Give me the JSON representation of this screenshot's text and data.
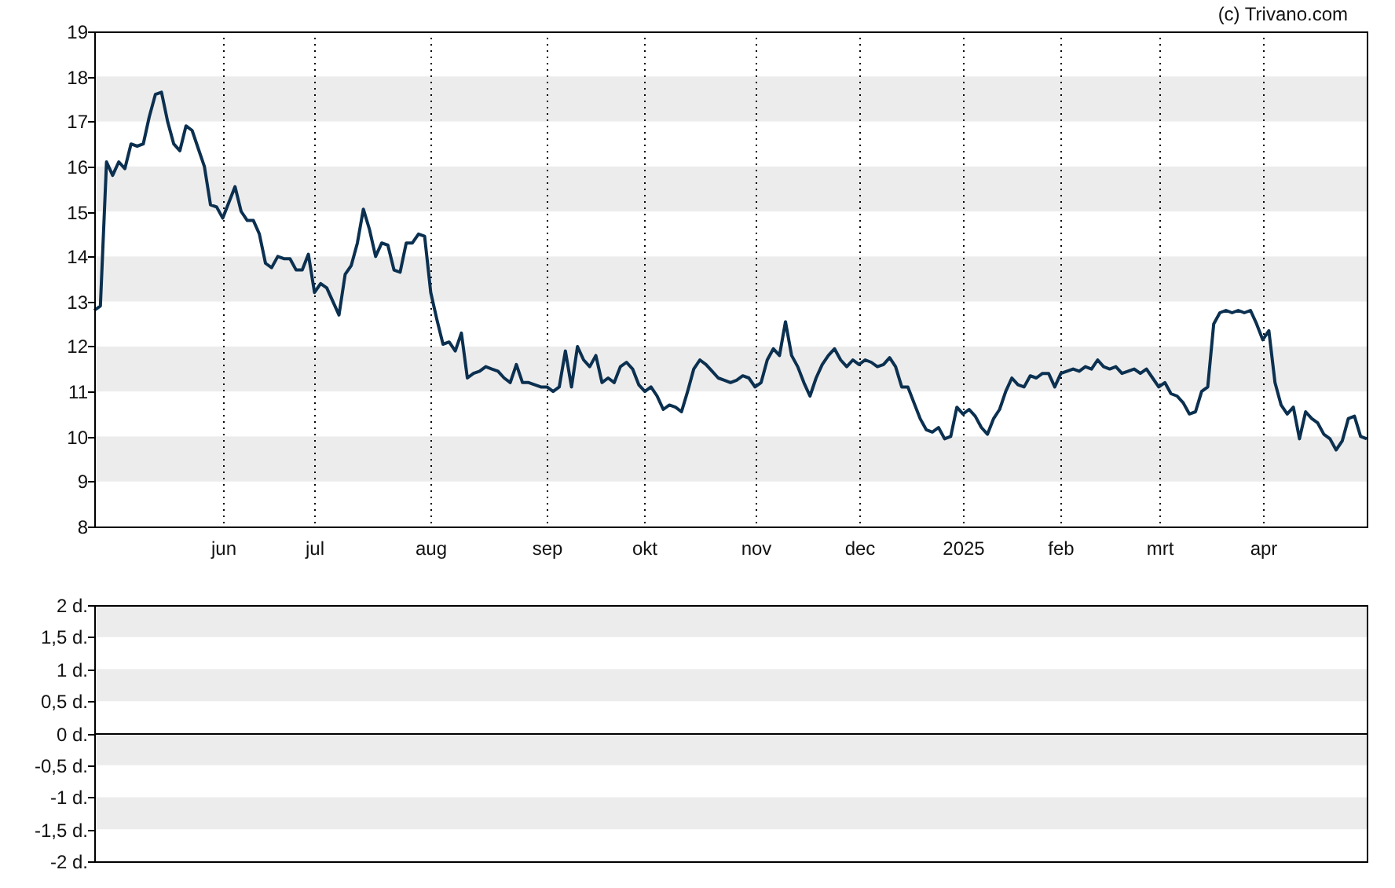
{
  "price_chart": {
    "copyright": "(c) Trivano.com",
    "chart_data": {
      "type": "line",
      "ylim": [
        8,
        19
      ],
      "yticks": [
        8,
        9,
        10,
        11,
        12,
        13,
        14,
        15,
        16,
        17,
        18,
        19
      ],
      "categories": [
        null,
        null,
        null,
        null,
        null,
        null,
        null,
        null,
        null,
        null,
        null,
        null,
        null,
        null,
        null,
        null,
        null,
        null,
        null,
        null,
        null,
        "jun",
        null,
        null,
        null,
        null,
        null,
        null,
        null,
        null,
        null,
        null,
        null,
        null,
        null,
        null,
        "jul",
        null,
        null,
        null,
        null,
        null,
        null,
        null,
        null,
        null,
        null,
        null,
        null,
        null,
        null,
        null,
        null,
        null,
        null,
        "aug",
        null,
        null,
        null,
        null,
        null,
        null,
        null,
        null,
        null,
        null,
        null,
        null,
        null,
        null,
        null,
        null,
        null,
        null,
        "sep",
        null,
        null,
        null,
        null,
        null,
        null,
        null,
        null,
        null,
        null,
        null,
        null,
        null,
        null,
        null,
        "okt",
        null,
        null,
        null,
        null,
        null,
        null,
        null,
        null,
        null,
        null,
        null,
        null,
        null,
        null,
        null,
        null,
        null,
        "nov",
        null,
        null,
        null,
        null,
        null,
        null,
        null,
        null,
        null,
        null,
        null,
        null,
        null,
        null,
        null,
        null,
        "dec",
        null,
        null,
        null,
        null,
        null,
        null,
        null,
        null,
        null,
        null,
        null,
        null,
        null,
        null,
        null,
        null,
        "2025",
        null,
        null,
        null,
        null,
        null,
        null,
        null,
        null,
        null,
        null,
        null,
        null,
        null,
        null,
        null,
        "feb",
        null,
        null,
        null,
        null,
        null,
        null,
        null,
        null,
        null,
        null,
        null,
        null,
        null,
        null,
        null,
        "mrt",
        null,
        null,
        null,
        null,
        null,
        null,
        null,
        null,
        null,
        null,
        null,
        null,
        null,
        null,
        null,
        null,
        "apr",
        null,
        null,
        null,
        null,
        null,
        null,
        null,
        null,
        null,
        null,
        null,
        null,
        null,
        null,
        null,
        null,
        null
      ],
      "series": [
        {
          "color": "#0b3050",
          "values": [
            12.8,
            12.9,
            16.1,
            15.8,
            16.1,
            15.95,
            16.5,
            16.45,
            16.5,
            17.1,
            17.6,
            17.65,
            17.0,
            16.5,
            16.35,
            16.9,
            16.8,
            16.4,
            16.0,
            15.15,
            15.1,
            14.85,
            15.2,
            15.55,
            15.0,
            14.8,
            14.8,
            14.5,
            13.85,
            13.75,
            14.0,
            13.95,
            13.95,
            13.7,
            13.7,
            14.05,
            13.2,
            13.4,
            13.3,
            13.0,
            12.7,
            13.6,
            13.8,
            14.3,
            15.05,
            14.6,
            14.0,
            14.3,
            14.25,
            13.7,
            13.65,
            14.3,
            14.3,
            14.5,
            14.45,
            13.2,
            12.6,
            12.05,
            12.1,
            11.9,
            12.3,
            11.3,
            11.4,
            11.45,
            11.55,
            11.5,
            11.45,
            11.3,
            11.2,
            11.6,
            11.2,
            11.2,
            11.15,
            11.1,
            11.1,
            11.0,
            11.1,
            11.9,
            11.1,
            12.0,
            11.7,
            11.55,
            11.8,
            11.2,
            11.3,
            11.2,
            11.55,
            11.65,
            11.5,
            11.15,
            11.0,
            11.1,
            10.9,
            10.6,
            10.7,
            10.65,
            10.55,
            11.0,
            11.5,
            11.7,
            11.6,
            11.45,
            11.3,
            11.25,
            11.2,
            11.25,
            11.35,
            11.3,
            11.1,
            11.2,
            11.7,
            11.95,
            11.8,
            12.55,
            11.8,
            11.55,
            11.2,
            10.9,
            11.3,
            11.6,
            11.8,
            11.95,
            11.7,
            11.55,
            11.7,
            11.6,
            11.7,
            11.65,
            11.55,
            11.6,
            11.75,
            11.55,
            11.1,
            11.1,
            10.75,
            10.4,
            10.15,
            10.1,
            10.2,
            9.95,
            10.0,
            10.65,
            10.5,
            10.6,
            10.45,
            10.2,
            10.05,
            10.4,
            10.6,
            11.0,
            11.3,
            11.15,
            11.1,
            11.35,
            11.3,
            11.4,
            11.4,
            11.1,
            11.4,
            11.45,
            11.5,
            11.45,
            11.55,
            11.5,
            11.7,
            11.55,
            11.5,
            11.55,
            11.4,
            11.45,
            11.5,
            11.4,
            11.5,
            11.3,
            11.1,
            11.2,
            10.95,
            10.9,
            10.75,
            10.5,
            10.55,
            11.0,
            11.1,
            12.5,
            12.75,
            12.8,
            12.75,
            12.8,
            12.75,
            12.8,
            12.5,
            12.15,
            12.35,
            11.2,
            10.7,
            10.5,
            10.65,
            9.95,
            10.55,
            10.4,
            10.3,
            10.05,
            9.95,
            9.7,
            9.9,
            10.4,
            10.45,
            10.0,
            9.95
          ]
        }
      ]
    }
  },
  "change_panel": {
    "chart_data": {
      "type": "bar",
      "categories": [
        null,
        null
      ],
      "series": [
        {
          "values": [
            null,
            null
          ]
        }
      ],
      "ylim": [
        -2,
        2
      ],
      "yticks": [
        {
          "value": -2,
          "label": "-2 d."
        },
        {
          "value": -1.5,
          "label": "-1,5 d."
        },
        {
          "value": -1,
          "label": "-1 d."
        },
        {
          "value": -0.5,
          "label": "-0,5 d."
        },
        {
          "value": 0,
          "label": "0 d."
        },
        {
          "value": 0.5,
          "label": "0,5 d."
        },
        {
          "value": 1,
          "label": "1 d."
        },
        {
          "value": 1.5,
          "label": "1,5 d."
        },
        {
          "value": 2,
          "label": "2 d."
        }
      ]
    }
  }
}
